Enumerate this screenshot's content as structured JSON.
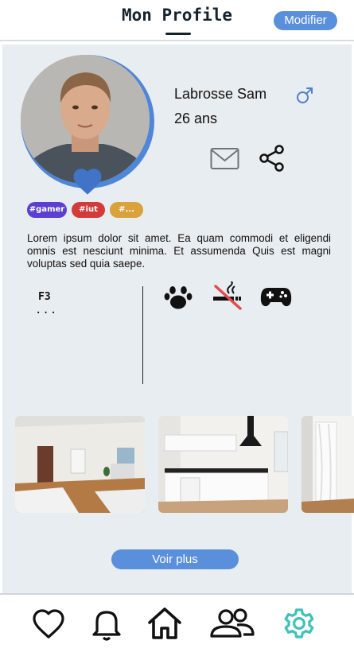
{
  "header": {
    "title": "Mon Profile",
    "modify_label": "Modifier"
  },
  "profile": {
    "name": "Labrosse Sam",
    "age": "26 ans",
    "tags": [
      {
        "label": "#gamer",
        "color": "#5a3fd1"
      },
      {
        "label": "#iut",
        "color": "#d33a3a"
      },
      {
        "label": "#...",
        "color": "#d9a23b"
      }
    ],
    "description": "Lorem ipsum dolor sit amet. Ea quam commodi et eligendi omnis est nesciunt minima. Et assumenda Quis est magni voluptas sed quia saepe."
  },
  "details": {
    "flat_type": "F3",
    "more": "..."
  },
  "preferences": [
    "paw-icon",
    "no-smoking-icon",
    "gamepad-icon"
  ],
  "photos": [
    "living-room-photo",
    "kitchen-photo",
    "bedroom-photo"
  ],
  "more_button": "Voir plus",
  "nav": {
    "items": [
      "heart-icon",
      "bell-icon",
      "home-icon",
      "users-icon",
      "gear-icon"
    ],
    "active": "gear-icon",
    "active_color": "#3fc1b8"
  },
  "colors": {
    "accent": "#5a8fdb",
    "background": "#e8edf1"
  }
}
